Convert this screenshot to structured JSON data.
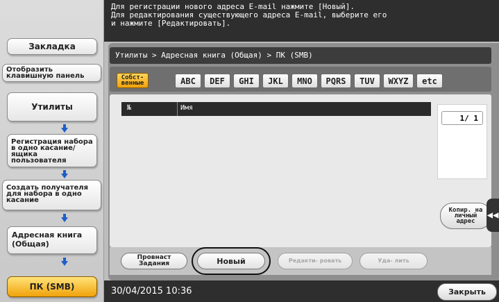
{
  "message": {
    "lines": [
      "Для регистрации нового адреса E-mail нажмите [Новый].",
      "Для редактирования существующего адреса E-mail, выберите его",
      "и нажмите [Редактировать]."
    ]
  },
  "sidebar": {
    "bookmark": "Закладка",
    "show_keypad": "Отобразить клавишную панель",
    "utilities": "Утилиты",
    "one_touch_registration": "Регистрация набора в одно касание/ящика пользователя",
    "create_destination": "Создать получателя для набора в одно касание",
    "address_book": "Адресная книга (Общая)",
    "pc_smb": "ПК (SMB)"
  },
  "breadcrumb": "Утилиты > Адресная книга (Общая) > ПК (SMB)",
  "index_tabs": [
    "Собст- венные",
    "ABC",
    "DEF",
    "GHI",
    "JKL",
    "MNO",
    "PQRS",
    "TUV",
    "WXYZ",
    "etc"
  ],
  "table": {
    "col_no": "№",
    "col_name": "Имя"
  },
  "pagination": "1/ 1",
  "copy_button": "Копир. на личный адрес",
  "scroll_tab": "◀◀",
  "bottom_buttons": {
    "check_job": "Провнаст Задания",
    "new": "Новый",
    "edit": "Редакти- ровать",
    "delete": "Уда- лить"
  },
  "status": {
    "datetime": "30/04/2015   10:36",
    "close": "Закрыть"
  },
  "colors": {
    "selected_tab": "#f0a20a",
    "arrow": "#1d5ec9",
    "dark_bar": "#2e2e2e"
  }
}
